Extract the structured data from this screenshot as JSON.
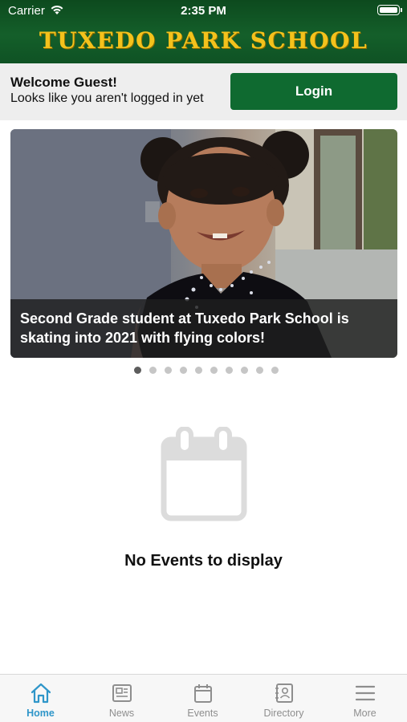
{
  "status_bar": {
    "carrier": "Carrier",
    "time": "2:35 PM",
    "wifi_icon": "wifi-icon",
    "battery_icon": "battery-icon"
  },
  "header": {
    "title": "TUXEDO PARK SCHOOL",
    "title_color": "#f4c21c",
    "background": "#0f5224"
  },
  "welcome": {
    "title": "Welcome Guest!",
    "subtitle": "Looks like you aren't logged in yet",
    "login_label": "Login",
    "login_color": "#0f6a30"
  },
  "carousel": {
    "caption": "Second Grade student at Tuxedo Park School is skating into 2021 with flying colors!",
    "total_slides": 10,
    "active_index": 0
  },
  "events": {
    "empty_icon": "calendar-icon",
    "empty_text": "No Events to display"
  },
  "tabbar": {
    "active_color": "#2f96c9",
    "items": [
      {
        "label": "Home",
        "icon": "home-icon",
        "active": true
      },
      {
        "label": "News",
        "icon": "newspaper-icon",
        "active": false
      },
      {
        "label": "Events",
        "icon": "calendar-icon",
        "active": false
      },
      {
        "label": "Directory",
        "icon": "directory-icon",
        "active": false
      },
      {
        "label": "More",
        "icon": "menu-icon",
        "active": false
      }
    ]
  }
}
